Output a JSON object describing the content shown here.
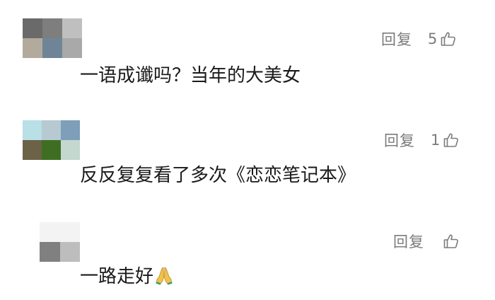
{
  "comments": [
    {
      "text": "一语成谶吗？当年的大美女",
      "reply_label": "回复",
      "like_count": "5",
      "avatar_colors": [
        "#6a6a6a",
        "#7e7e7e",
        "#bfbfbf",
        "#b3aa9e",
        "#6f8597",
        "#a9a9a9"
      ]
    },
    {
      "text": "反反复复看了多次《恋恋笔记本》",
      "reply_label": "回复",
      "like_count": "1",
      "avatar_colors": [
        "#b9dfe7",
        "#b7c9d1",
        "#7d9fb9",
        "#6b6248",
        "#3f6e22",
        "#c4d8d0"
      ]
    },
    {
      "text": "一路走好",
      "emoji": "folded-hands",
      "reply_label": "回复",
      "like_count": "",
      "avatar_colors": [
        "#f3f3f3",
        "#f3f3f3",
        "#f3f3f3",
        "#808080",
        "#bdbdbd",
        "#f8f8f8"
      ]
    }
  ]
}
